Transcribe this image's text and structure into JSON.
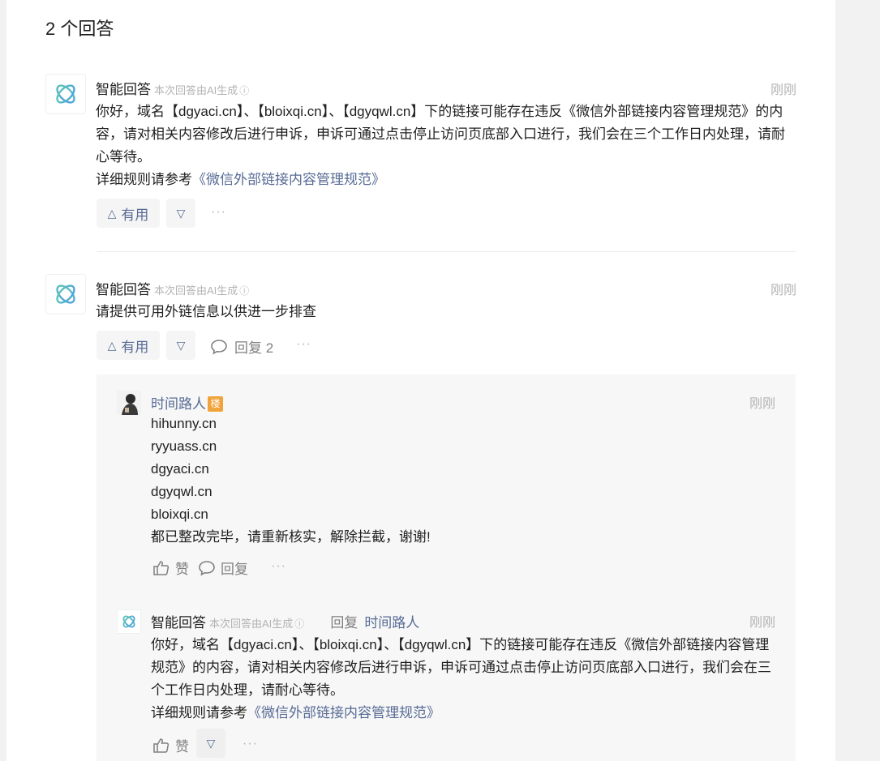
{
  "heading": "2 个回答",
  "colors": {
    "accent": "#576b95",
    "muted": "#b3b3b3",
    "badge": "#f0a33a",
    "logo_start": "#5fc9b6",
    "logo_end": "#4c9fe0"
  },
  "answers": [
    {
      "author": "智能回答",
      "ai_note": "本次回答由AI生成",
      "info_icon": "ⓘ",
      "time": "刚刚",
      "body": "你好，域名【dgyaci.cn】、【bloixqi.cn】、【dgyqwl.cn】下的链接可能存在违反《微信外部链接内容管理规范》的内容，请对相关内容修改后进行申诉，申诉可通过点击停止访问页底部入口进行，我们会在三个工作日内处理，请耐心等待。",
      "ref_prefix": "详细规则请参考",
      "ref_link": "《微信外部链接内容管理规范》",
      "useful_label": "有用",
      "up_icon": "△",
      "down_icon": "▽",
      "more": "···"
    },
    {
      "author": "智能回答",
      "ai_note": "本次回答由AI生成",
      "info_icon": "ⓘ",
      "time": "刚刚",
      "body": "请提供可用外链信息以供进一步排查",
      "useful_label": "有用",
      "up_icon": "△",
      "down_icon": "▽",
      "reply_label": "回复 2",
      "more": "···"
    }
  ],
  "thread": {
    "user_reply": {
      "author": "时间路人",
      "badge": "楼",
      "time": "刚刚",
      "lines": [
        "hihunny.cn",
        "ryyuass.cn",
        "dgyaci.cn",
        "dgyqwl.cn",
        "bloixqi.cn",
        "都已整改完毕，请重新核实，解除拦截，谢谢!"
      ],
      "like_label": "赞",
      "reply_label": "回复",
      "more": "···"
    },
    "ai_reply": {
      "author": "智能回答",
      "ai_note": "本次回答由AI生成",
      "info_icon": "ⓘ",
      "reply_to_label": "回复",
      "reply_to_user": "时间路人",
      "time": "刚刚",
      "body": "你好，域名【dgyaci.cn】、【bloixqi.cn】、【dgyqwl.cn】下的链接可能存在违反《微信外部链接内容管理规范》的内容，请对相关内容修改后进行申诉，申诉可通过点击停止访问页底部入口进行，我们会在三个工作日内处理，请耐心等待。",
      "ref_prefix": "详细规则请参考",
      "ref_link": "《微信外部链接内容管理规范》",
      "like_label": "赞",
      "down_icon": "▽",
      "more": "···"
    }
  }
}
